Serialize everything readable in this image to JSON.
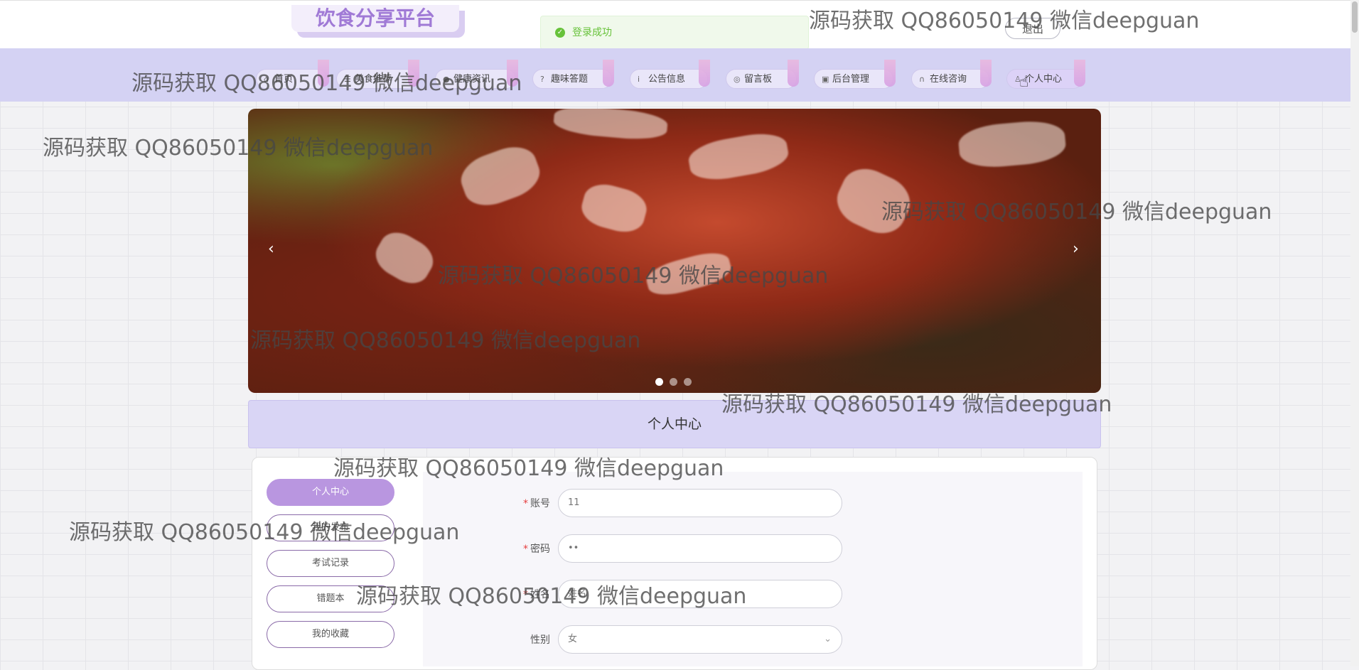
{
  "header": {
    "logo_text": "饮食分享平台",
    "logout_label": "退出"
  },
  "toast": {
    "message": "登录成功",
    "type": "success"
  },
  "nav": {
    "items": [
      {
        "label": "首页",
        "icon": "home-icon"
      },
      {
        "label": "美食推荐",
        "icon": "food-icon"
      },
      {
        "label": "健康资讯",
        "icon": "info-icon"
      },
      {
        "label": "趣味答题",
        "icon": "question-icon"
      },
      {
        "label": "公告信息",
        "icon": "notice-icon"
      },
      {
        "label": "留言板",
        "icon": "message-icon"
      },
      {
        "label": "后台管理",
        "icon": "admin-icon"
      },
      {
        "label": "在线咨询",
        "icon": "headset-icon"
      },
      {
        "label": "个人中心",
        "icon": "user-icon"
      }
    ],
    "active_index": 8
  },
  "banner": {
    "slide_count": 3,
    "active_slide": 0
  },
  "section": {
    "title": "个人中心"
  },
  "sidebar": {
    "items": [
      {
        "label": "个人中心",
        "active": true
      },
      {
        "label": "我的发布",
        "active": false
      },
      {
        "label": "考试记录",
        "active": false
      },
      {
        "label": "错题本",
        "active": false
      },
      {
        "label": "我的收藏",
        "active": false
      }
    ]
  },
  "form": {
    "fields": [
      {
        "label": "账号",
        "required": true,
        "value": "11"
      },
      {
        "label": "密码",
        "required": true,
        "value": "••"
      },
      {
        "label": "姓名",
        "required": true,
        "value": "姓名"
      },
      {
        "label": "性别",
        "required": false,
        "value": "女"
      }
    ]
  },
  "watermark_text": "源码获取 QQ86050149 微信deepguan",
  "colors": {
    "nav_bg": "#d4d2f3",
    "accent": "#b996e0",
    "logo": "#a07ad6",
    "success": "#67c23a"
  }
}
